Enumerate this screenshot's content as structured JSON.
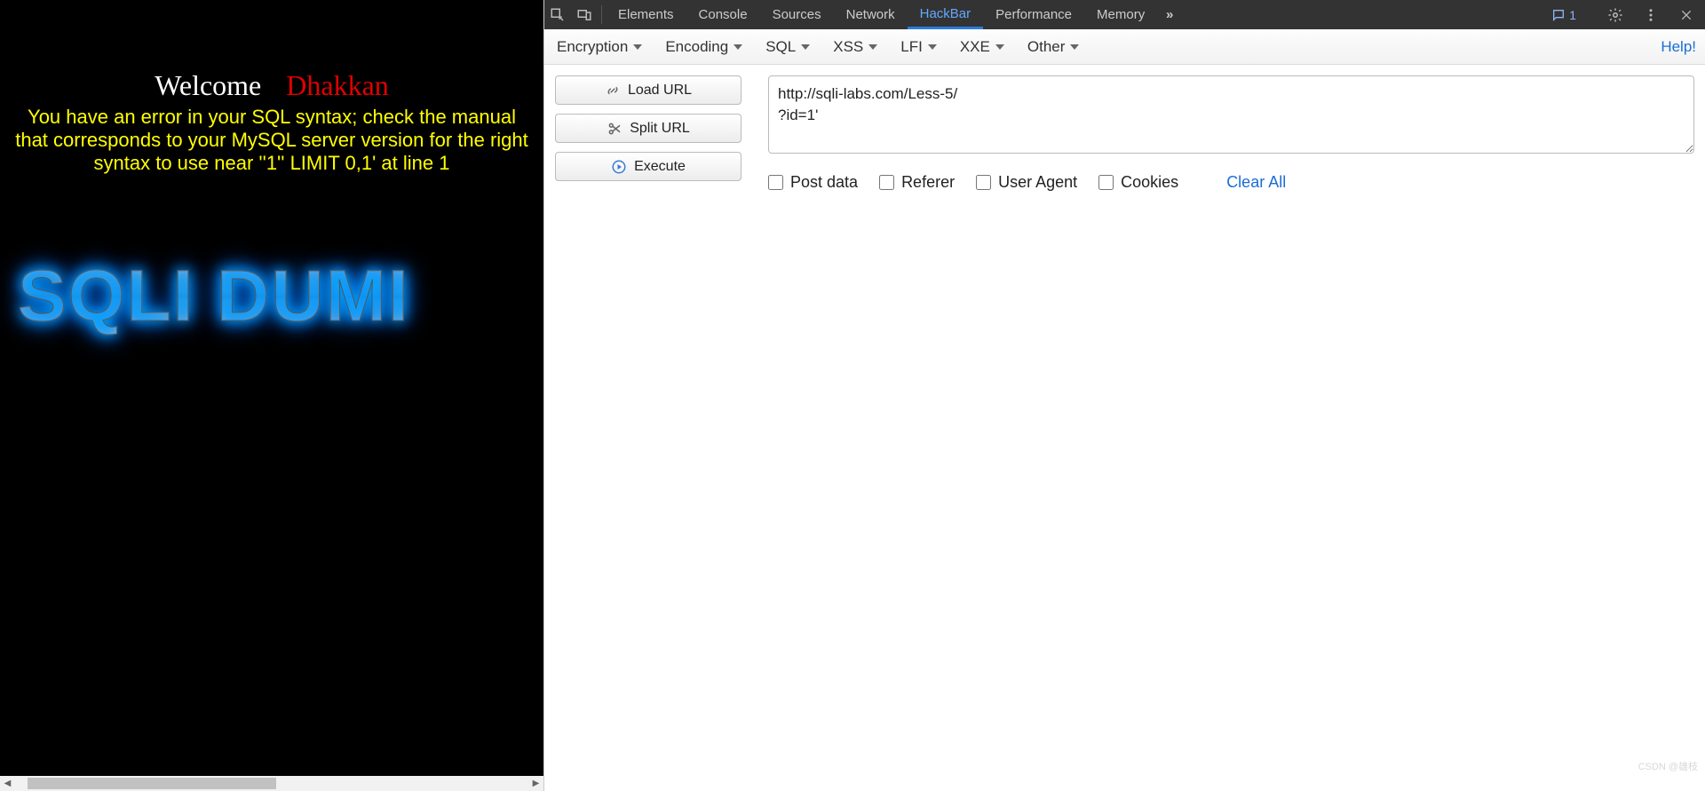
{
  "page": {
    "welcome": "Welcome",
    "dhakkan": "Dhakkan",
    "error": "You have an error in your SQL syntax; check the manual that corresponds to your MySQL server version for the right syntax to use near ''1'' LIMIT 0,1' at line 1",
    "logo_text": "SQLI DUMI"
  },
  "devtools": {
    "tabs": {
      "elements": "Elements",
      "console": "Console",
      "sources": "Sources",
      "network": "Network",
      "hackbar": "HackBar",
      "performance": "Performance",
      "memory": "Memory"
    },
    "more_tabs_glyph": "»",
    "messages_count": "1"
  },
  "hackbar": {
    "menus": {
      "encryption": "Encryption",
      "encoding": "Encoding",
      "sql": "SQL",
      "xss": "XSS",
      "lfi": "LFI",
      "xxe": "XXE",
      "other": "Other"
    },
    "help": "Help!",
    "buttons": {
      "load_url": "Load URL",
      "split_url": "Split URL",
      "execute": "Execute"
    },
    "url_value": "http://sqli-labs.com/Less-5/\n?id=1'",
    "checks": {
      "post_data": "Post data",
      "referer": "Referer",
      "user_agent": "User Agent",
      "cookies": "Cookies"
    },
    "clear_all": "Clear All"
  },
  "watermark": "CSDN @雄枝"
}
